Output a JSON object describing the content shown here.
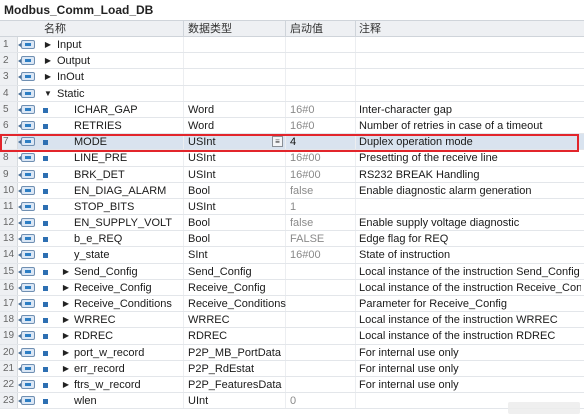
{
  "db_title": "Modbus_Comm_Load_DB",
  "headers": {
    "name": "名称",
    "datatype": "数据类型",
    "start_value": "启动值",
    "comment": "注释"
  },
  "rows": [
    {
      "num": "1",
      "name": "Input",
      "type": "",
      "start": "",
      "comment": ""
    },
    {
      "num": "2",
      "name": "Output",
      "type": "",
      "start": "",
      "comment": ""
    },
    {
      "num": "3",
      "name": "InOut",
      "type": "",
      "start": "",
      "comment": ""
    },
    {
      "num": "4",
      "name": "Static",
      "type": "",
      "start": "",
      "comment": ""
    },
    {
      "num": "5",
      "name": "ICHAR_GAP",
      "type": "Word",
      "start": "16#0",
      "comment": "Inter-character gap"
    },
    {
      "num": "6",
      "name": "RETRIES",
      "type": "Word",
      "start": "16#0",
      "comment": "Number of retries in case of a timeout"
    },
    {
      "num": "7",
      "name": "MODE",
      "type": "USInt",
      "start": "4",
      "comment": "Duplex operation mode"
    },
    {
      "num": "8",
      "name": "LINE_PRE",
      "type": "USInt",
      "start": "16#00",
      "comment": "Presetting of the receive line"
    },
    {
      "num": "9",
      "name": "BRK_DET",
      "type": "USInt",
      "start": "16#00",
      "comment": "RS232 BREAK Handling"
    },
    {
      "num": "10",
      "name": "EN_DIAG_ALARM",
      "type": "Bool",
      "start": "false",
      "comment": "Enable diagnostic alarm generation"
    },
    {
      "num": "11",
      "name": "STOP_BITS",
      "type": "USInt",
      "start": "1",
      "comment": ""
    },
    {
      "num": "12",
      "name": "EN_SUPPLY_VOLT",
      "type": "Bool",
      "start": "false",
      "comment": "Enable supply voltage diagnostic"
    },
    {
      "num": "13",
      "name": "b_e_REQ",
      "type": "Bool",
      "start": "FALSE",
      "comment": "Edge flag for REQ"
    },
    {
      "num": "14",
      "name": "y_state",
      "type": "SInt",
      "start": "16#00",
      "comment": "State of instruction"
    },
    {
      "num": "15",
      "name": "Send_Config",
      "type": "Send_Config",
      "start": "",
      "comment": "Local instance of the instruction Send_Config"
    },
    {
      "num": "16",
      "name": "Receive_Config",
      "type": "Receive_Config",
      "start": "",
      "comment": "Local instance of the instruction Receive_Conf.."
    },
    {
      "num": "17",
      "name": "Receive_Conditions",
      "type": "Receive_Conditions",
      "start": "",
      "comment": "Parameter for Receive_Config"
    },
    {
      "num": "18",
      "name": "WRREC",
      "type": "WRREC",
      "start": "",
      "comment": "Local instance of the instruction WRREC"
    },
    {
      "num": "19",
      "name": "RDREC",
      "type": "RDREC",
      "start": "",
      "comment": "Local instance of the instruction RDREC"
    },
    {
      "num": "20",
      "name": "port_w_record",
      "type": "P2P_MB_PortData",
      "start": "",
      "comment": "For internal use only"
    },
    {
      "num": "21",
      "name": "err_record",
      "type": "P2P_RdEstat",
      "start": "",
      "comment": "For internal use only"
    },
    {
      "num": "22",
      "name": "ftrs_w_record",
      "type": "P2P_FeaturesData",
      "start": "",
      "comment": "For internal use only"
    },
    {
      "num": "23",
      "name": "wlen",
      "type": "UInt",
      "start": "0",
      "comment": ""
    }
  ],
  "selected_row": "7",
  "icons": {
    "interface": "interface-block-icon",
    "expand": "expand-arrow-icon",
    "collapse": "collapse-arrow-icon",
    "variable": "variable-square-icon",
    "dropdown": "dropdown-list-icon"
  },
  "colors": {
    "highlight": "#e2252b",
    "selected_bg": "#d9e3ef"
  }
}
